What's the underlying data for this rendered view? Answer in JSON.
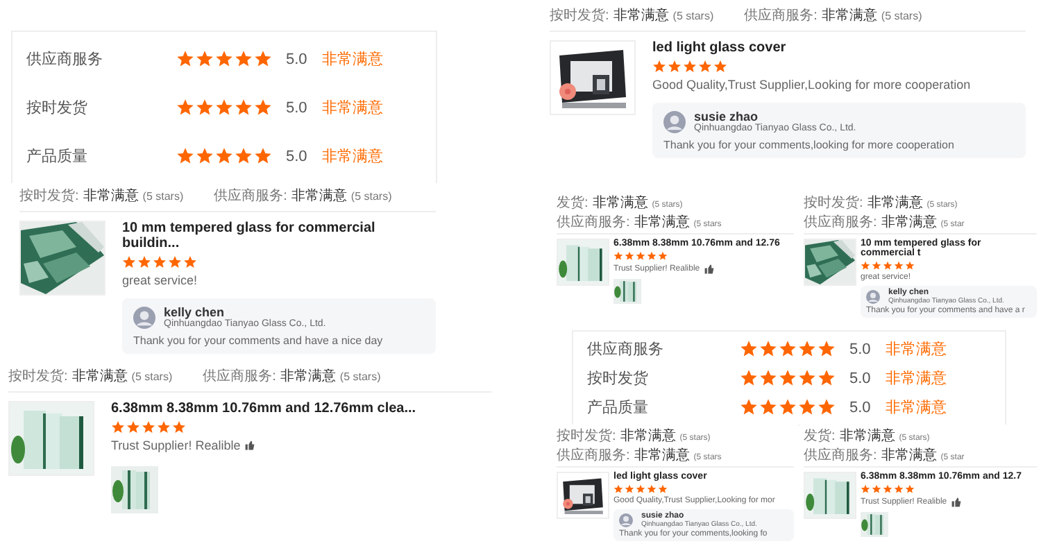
{
  "panels": [
    {
      "kind": "ratings",
      "rows": [
        {
          "label": "供应商服务",
          "stars": 5,
          "score": "5.0",
          "verdict": "非常满意"
        },
        {
          "label": "按时发货",
          "stars": 5,
          "score": "5.0",
          "verdict": "非常满意"
        },
        {
          "label": "产品质量",
          "stars": 5,
          "score": "5.0",
          "verdict": "非常满意"
        }
      ]
    },
    {
      "kind": "review",
      "meta": [
        {
          "label": "按时发货:",
          "value": "非常满意",
          "note": "(5 stars)"
        },
        {
          "label": "供应商服务:",
          "value": "非常满意",
          "note": "(5 stars)"
        }
      ],
      "image": {
        "kind": "picture"
      },
      "title": "led light glass cover",
      "stars": 5,
      "comment": "Good Quality,Trust Supplier,Looking for more cooperation",
      "reply": {
        "name": "susie zhao",
        "company": "Qinhuangdao Tianyao Glass Co., Ltd.",
        "text": "Thank you for your comments,looking for more cooperation"
      }
    },
    {
      "kind": "review",
      "meta": [
        {
          "label": "按时发货:",
          "value": "非常满意",
          "note": "(5 stars)"
        },
        {
          "label": "供应商服务:",
          "value": "非常满意",
          "note": "(5 stars)"
        }
      ],
      "image": {
        "kind": "picture"
      },
      "title": "10 mm tempered glass for commercial buildin...",
      "stars": 5,
      "comment": "great service!",
      "reply": {
        "name": "kelly chen",
        "company": "Qinhuangdao Tianyao Glass Co., Ltd.",
        "text": "Thank you for your comments and have a nice day"
      }
    },
    {
      "kind": "review",
      "meta": [
        {
          "label": "发货:",
          "value": "非常满意",
          "note": "(5 stars)"
        },
        {
          "label": "供应商服务:",
          "value": "非常满意",
          "note": "(5 stars"
        }
      ],
      "image": {
        "kind": "picture"
      },
      "title": "6.38mm 8.38mm 10.76mm and 12.76",
      "stars": 5,
      "comment": "Trust Supplier! Realible",
      "thumbnail": {
        "kind": "picture"
      }
    },
    {
      "kind": "review",
      "meta": [
        {
          "label": "按时发货:",
          "value": "非常满意",
          "note": "(5 stars)"
        },
        {
          "label": "供应商服务:",
          "value": "非常满意",
          "note": "(5 star"
        }
      ],
      "image": {
        "kind": "picture"
      },
      "title": "10 mm tempered glass for commercial t",
      "stars": 5,
      "comment": "great service!",
      "reply": {
        "name": "kelly chen",
        "company": "Qinhuangdao Tianyao Glass Co., Ltd.",
        "text": "Thank you for your comments and have a r"
      }
    },
    {
      "kind": "ratings",
      "rows": [
        {
          "label": "供应商服务",
          "stars": 5,
          "score": "5.0",
          "verdict": "非常满意"
        },
        {
          "label": "按时发货",
          "stars": 5,
          "score": "5.0",
          "verdict": "非常满意"
        },
        {
          "label": "产品质量",
          "stars": 5,
          "score": "5.0",
          "verdict": "非常满意"
        }
      ]
    },
    {
      "kind": "review",
      "meta": [
        {
          "label": "按时发货:",
          "value": "非常满意",
          "note": "(5 stars)"
        },
        {
          "label": "供应商服务:",
          "value": "非常满意",
          "note": "(5 stars)"
        }
      ],
      "image": {
        "kind": "picture"
      },
      "title": "6.38mm 8.38mm 10.76mm and 12.76mm clea...",
      "stars": 5,
      "comment": "Trust Supplier! Realible",
      "thumbnail": {
        "kind": "picture"
      }
    },
    {
      "kind": "review",
      "meta": [
        {
          "label": "按时发货:",
          "value": "非常满意",
          "note": "(5 stars)"
        },
        {
          "label": "供应商服务:",
          "value": "非常满意",
          "note": "(5 stars"
        }
      ],
      "image": {
        "kind": "picture"
      },
      "title": "led light glass cover",
      "stars": 5,
      "comment": "Good Quality,Trust Supplier,Looking for mor",
      "reply": {
        "name": "susie zhao",
        "company": "Qinhuangdao Tianyao Glass Co., Ltd.",
        "text": "Thank you for your comments,looking fo"
      }
    },
    {
      "kind": "review",
      "meta": [
        {
          "label": "发货:",
          "value": "非常满意",
          "note": "(5 stars)"
        },
        {
          "label": "供应商服务:",
          "value": "非常满意",
          "note": "(5 star"
        }
      ],
      "image": {
        "kind": "picture"
      },
      "title": "6.38mm 8.38mm 10.76mm and 12.7",
      "stars": 5,
      "comment": "Trust Supplier! Realible",
      "thumbnail": {
        "kind": "picture"
      }
    }
  ]
}
